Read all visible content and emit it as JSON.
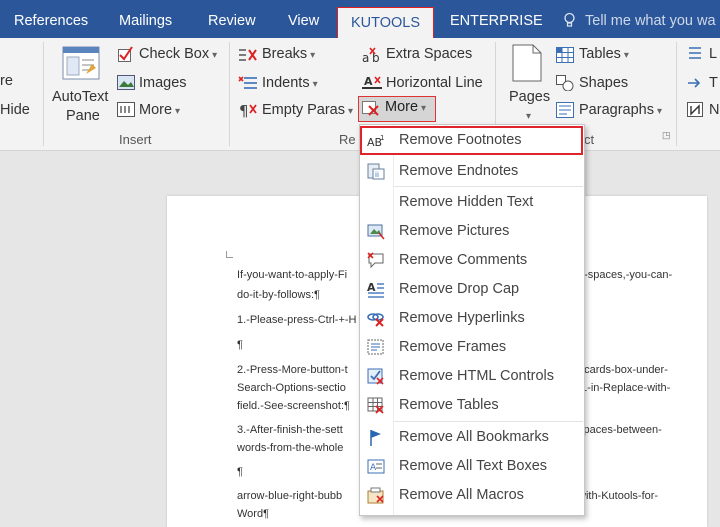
{
  "tabs": [
    {
      "label": "References"
    },
    {
      "label": "Mailings"
    },
    {
      "label": "Review"
    },
    {
      "label": "View"
    },
    {
      "label": "KUTOOLS"
    },
    {
      "label": "ENTERPRISE"
    }
  ],
  "tell_me": "Tell me what you wa",
  "ribbon": {
    "left_partial_1": "re",
    "left_partial_2": "Hide",
    "autotext_line1": "AutoText",
    "autotext_line2": "Pane",
    "check_box": "Check Box",
    "images": "Images",
    "more_insert": "More",
    "insert_group": "Insert",
    "breaks": "Breaks",
    "indents": "Indents",
    "empty_paras": "Empty Paras",
    "extra_spaces": "Extra Spaces",
    "horizontal_line": "Horizontal Line",
    "more_remove": "More",
    "remove_group_partial": "Re",
    "pages": "Pages",
    "tables": "Tables",
    "shapes": "Shapes",
    "paragraphs": "Paragraphs",
    "select_group_partial": "ct",
    "far_right_1": "L",
    "far_right_2": "T",
    "far_right_3": "N"
  },
  "document": {
    "lines": [
      {
        "left": "If-you-want-to-apply-Fi",
        "right": "a-spaces,-you-can-"
      },
      {
        "left": "do-it-by-follows:¶",
        "right": ""
      },
      {
        "left": "1.-Please-press-Ctrl-+-H",
        "right": "¶"
      },
      {
        "left": "¶",
        "right": ""
      },
      {
        "left": "2.-Press-More-button-t",
        "right": "dcards-box-under-"
      },
      {
        "left": "Search-Options-sectio",
        "right": "\\1-in-Replace-with-"
      },
      {
        "left": "field.-See-screenshot:¶",
        "right": ""
      },
      {
        "left": "3.-After-finish-the-sett",
        "right": "spaces-between-"
      },
      {
        "left": "words-from-the-whole",
        "right": ""
      },
      {
        "left": "¶",
        "right": ""
      },
      {
        "left": "arrow-blue-right-bubb",
        "right": "with-Kutools-for-"
      },
      {
        "left": "Word¶",
        "right": ""
      }
    ]
  },
  "menu": {
    "items": [
      {
        "label": "Remove Footnotes",
        "icon": "footnote-icon"
      },
      {
        "label": "Remove Endnotes",
        "icon": "endnote-icon"
      },
      {
        "label": "Remove Hidden Text",
        "icon": ""
      },
      {
        "label": "Remove Pictures",
        "icon": "picture-icon"
      },
      {
        "label": "Remove Comments",
        "icon": "comment-icon"
      },
      {
        "label": "Remove Drop Cap",
        "icon": "drop-cap-icon"
      },
      {
        "label": "Remove Hyperlinks",
        "icon": "hyperlink-icon"
      },
      {
        "label": "Remove Frames",
        "icon": "frame-icon"
      },
      {
        "label": "Remove HTML Controls",
        "icon": "html-control-icon"
      },
      {
        "label": "Remove Tables",
        "icon": "table-icon"
      },
      {
        "label": "Remove All Bookmarks",
        "icon": "bookmark-icon"
      },
      {
        "label": "Remove All Text Boxes",
        "icon": "text-box-icon"
      },
      {
        "label": "Remove All Macros",
        "icon": "macro-icon"
      }
    ]
  },
  "colors": {
    "tab_bar": "#2b579a",
    "highlight_border": "#e0242c"
  }
}
